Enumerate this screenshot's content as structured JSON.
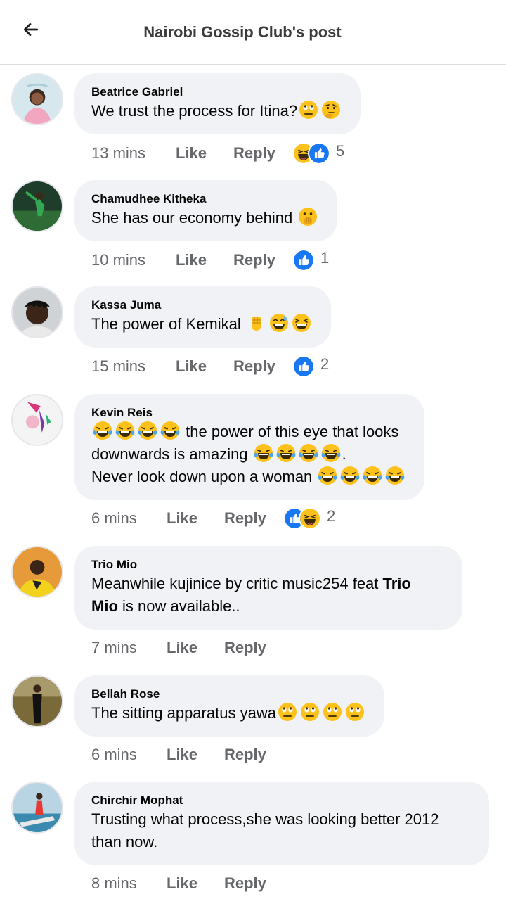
{
  "header": {
    "title": "Nairobi Gossip Club's post",
    "back_icon": "arrow-left-icon"
  },
  "comments": [
    {
      "author": "Beatrice Gabriel",
      "text_parts": [
        "We trust the process for Itina?"
      ],
      "emojis": [
        "rolling-eyes-emoji",
        "thinking-emoji"
      ],
      "time": "13 mins",
      "like_label": "Like",
      "reply_label": "Reply",
      "reactions": [
        "haha-reaction-icon",
        "like-reaction-icon"
      ],
      "reaction_count": "5"
    },
    {
      "author": "Chamudhee Kitheka",
      "text_parts": [
        "She has our economy behind"
      ],
      "emojis": [
        "hand-over-mouth-emoji"
      ],
      "time": "10 mins",
      "like_label": "Like",
      "reply_label": "Reply",
      "reactions": [
        "like-reaction-icon"
      ],
      "reaction_count": "1"
    },
    {
      "author": "Kassa Juma",
      "text_parts": [
        "The power of Kemikal"
      ],
      "emojis": [
        "raised-fist-emoji",
        "grinning-sweat-emoji",
        "grinning-squinting-emoji"
      ],
      "time": "15 mins",
      "like_label": "Like",
      "reply_label": "Reply",
      "reactions": [
        "like-reaction-icon"
      ],
      "reaction_count": "2"
    },
    {
      "author": "Kevin Reis",
      "text_parts": [
        "the power of this eye that looks",
        "downwards is amazing",
        ".",
        "Never look down upon a woman"
      ],
      "emojis": [
        "tears-of-joy-emoji"
      ],
      "time": "6 mins",
      "like_label": "Like",
      "reply_label": "Reply",
      "reactions": [
        "like-reaction-icon",
        "haha-reaction-icon"
      ],
      "reaction_count": "2"
    },
    {
      "author": "Trio Mio",
      "text_parts": [
        "Meanwhile kujinice by critic music254 feat ",
        "Trio",
        "Mio",
        " is now available.."
      ],
      "time": "7 mins",
      "like_label": "Like",
      "reply_label": "Reply"
    },
    {
      "author": "Bellah Rose",
      "text_parts": [
        "The sitting apparatus yawa"
      ],
      "emojis": [
        "rolling-eyes-emoji"
      ],
      "time": "6 mins",
      "like_label": "Like",
      "reply_label": "Reply"
    },
    {
      "author": "Chirchir Mophat",
      "text_parts": [
        "Trusting what process,she was looking better 2012",
        "than now."
      ],
      "time": "8 mins",
      "like_label": "Like",
      "reply_label": "Reply"
    }
  ],
  "colors": {
    "like_blue": "#1877f2",
    "emoji_yellow": "#fcc21b",
    "bubble_bg": "#f0f2f5",
    "meta_gray": "#65676b"
  }
}
